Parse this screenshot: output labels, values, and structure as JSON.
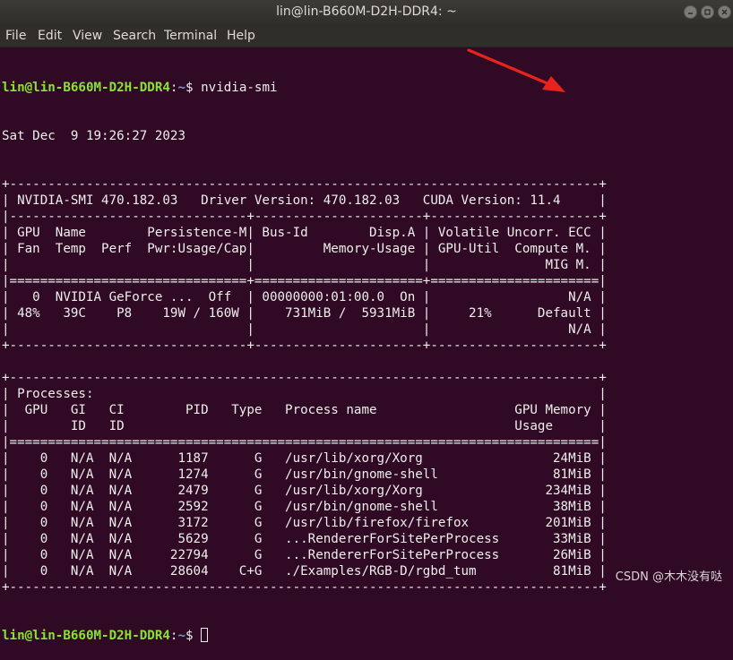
{
  "window": {
    "title": "lin@lin-B660M-D2H-DDR4: ~"
  },
  "menu": {
    "file": "File",
    "edit": "Edit",
    "view": "View",
    "search": "Search",
    "terminal": "Terminal",
    "help": "Help"
  },
  "prompt": {
    "user_host": "lin@lin-B660M-D2H-DDR4",
    "sep": ":",
    "path": "~",
    "symbol": "$ ",
    "command": "nvidia-smi"
  },
  "output": {
    "date": "Sat Dec  9 19:26:27 2023",
    "lines": [
      "+-----------------------------------------------------------------------------+",
      "| NVIDIA-SMI 470.182.03   Driver Version: 470.182.03   CUDA Version: 11.4     |",
      "|-------------------------------+----------------------+----------------------+",
      "| GPU  Name        Persistence-M| Bus-Id        Disp.A | Volatile Uncorr. ECC |",
      "| Fan  Temp  Perf  Pwr:Usage/Cap|         Memory-Usage | GPU-Util  Compute M. |",
      "|                               |                      |               MIG M. |",
      "|===============================+======================+======================|",
      "|   0  NVIDIA GeForce ...  Off  | 00000000:01:00.0  On |                  N/A |",
      "| 48%   39C    P8    19W / 160W |    731MiB /  5931MiB |     21%      Default |",
      "|                               |                      |                  N/A |",
      "+-------------------------------+----------------------+----------------------+",
      "",
      "+-----------------------------------------------------------------------------+",
      "| Processes:                                                                  |",
      "|  GPU   GI   CI        PID   Type   Process name                  GPU Memory |",
      "|        ID   ID                                                   Usage      |",
      "|=============================================================================|",
      "|    0   N/A  N/A      1187      G   /usr/lib/xorg/Xorg                 24MiB |",
      "|    0   N/A  N/A      1274      G   /usr/bin/gnome-shell               81MiB |",
      "|    0   N/A  N/A      2479      G   /usr/lib/xorg/Xorg                234MiB |",
      "|    0   N/A  N/A      2592      G   /usr/bin/gnome-shell               38MiB |",
      "|    0   N/A  N/A      3172      G   /usr/lib/firefox/firefox          201MiB |",
      "|    0   N/A  N/A      5629      G   ...RendererForSitePerProcess       33MiB |",
      "|    0   N/A  N/A     22794      G   ...RendererForSitePerProcess       26MiB |",
      "|    0   N/A  N/A     28604    C+G   ./Examples/RGB-D/rgbd_tum          81MiB |",
      "+-----------------------------------------------------------------------------+"
    ]
  },
  "watermark": "CSDN @木木没有哒",
  "colors": {
    "background": "#300a24",
    "user_host": "#8ae234",
    "path": "#729fcf",
    "annotation_arrow": "#e8231e"
  }
}
